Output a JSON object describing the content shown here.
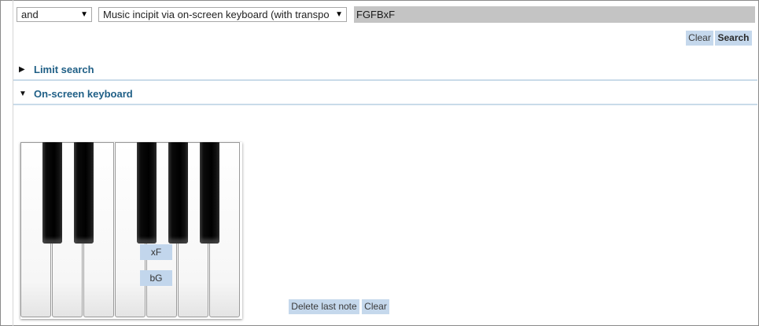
{
  "search_row": {
    "operator_select": "and",
    "field_select": "Music incipit via on-screen keyboard (with transpo",
    "query_value": "FGFBxF",
    "clear_label": "Clear",
    "search_label": "Search"
  },
  "sections": [
    {
      "label": "Limit search",
      "state": "collapsed"
    },
    {
      "label": "On-screen keyboard",
      "state": "expanded"
    }
  ],
  "keyboard": {
    "white_keys": 7,
    "black_keys": 5,
    "note_labels": [
      "xF",
      "bG"
    ],
    "delete_last_label": "Delete last note",
    "clear_label": "Clear"
  },
  "colors": {
    "button_bg": "#c5d8ec",
    "section_text": "#1f5f86",
    "section_rule": "#c9dbe9",
    "query_bg": "#c4c4c4"
  },
  "icons": {
    "dropdown": "triangle-down",
    "collapsed": "triangle-right",
    "expanded": "triangle-down"
  }
}
